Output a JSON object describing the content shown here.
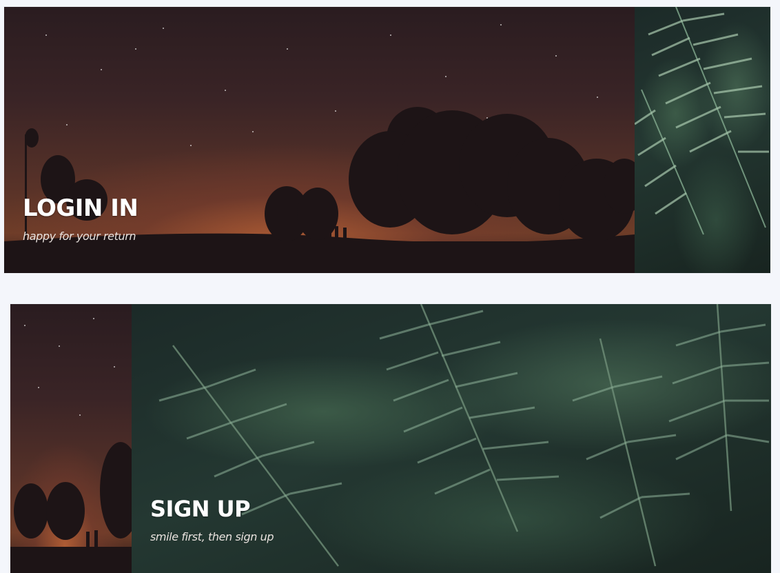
{
  "login_card": {
    "title": "LOGIN IN",
    "subtitle": "happy for your return"
  },
  "signup_card": {
    "title": "SIGN UP",
    "subtitle": "smile first, then sign up"
  },
  "colors": {
    "page_background": "#f4f6fb",
    "title_text": "#ffffff",
    "subtitle_text": "#e9e2de",
    "sky_glow": "#6e3d28",
    "fern_green": "#4f7a5c"
  },
  "images": {
    "login_main": "night-sky-tree-silhouette",
    "login_side": "fern-leaves",
    "signup_side": "night-sky-tree-silhouette",
    "signup_main": "fern-leaves"
  }
}
